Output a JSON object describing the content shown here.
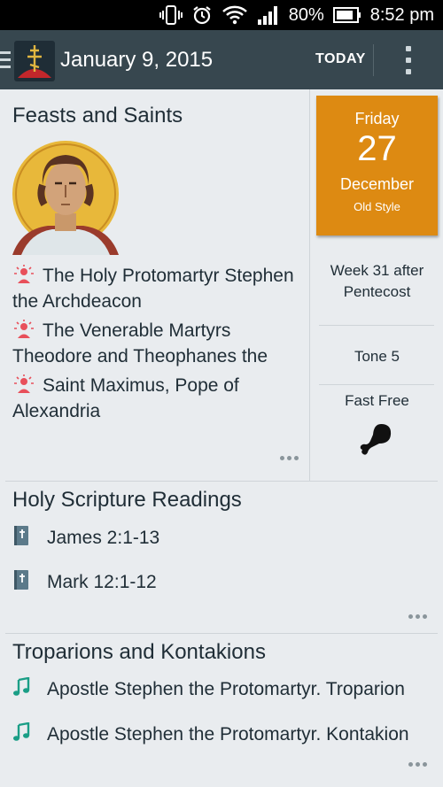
{
  "status_bar": {
    "battery": "80%",
    "time": "8:52 pm"
  },
  "action_bar": {
    "title": "January 9, 2015",
    "today_label": "TODAY"
  },
  "feasts": {
    "title": "Feasts and Saints",
    "saints": [
      "The Holy Protomartyr Stephen the Archdeacon",
      "The Venerable Martyrs Theodore and Theophanes the",
      "Saint Maximus, Pope of Alexandria"
    ]
  },
  "date_tile": {
    "weekday": "Friday",
    "day": "27",
    "month": "December",
    "style": "Old Style"
  },
  "week": "Week 31 after Pentecost",
  "tone": "Tone 5",
  "fast": "Fast Free",
  "readings": {
    "title": "Holy Scripture Readings",
    "items": [
      "James 2:1-13",
      "Mark 12:1-12"
    ]
  },
  "troparions": {
    "title": "Troparions and Kontakions",
    "items": [
      "Apostle Stephen the Protomartyr. Troparion",
      "Apostle Stephen the Protomartyr. Kontakion"
    ]
  },
  "colors": {
    "accent_tile": "#dd8a12",
    "action_bar": "#37474f",
    "saint_icon": "#e8505b",
    "music_icon": "#1a9e86",
    "book_icon": "#5c7a8a"
  },
  "icons": {
    "vibrate": "vibrate-icon",
    "alarm": "alarm-icon",
    "wifi": "wifi-icon",
    "signal": "signal-icon",
    "battery": "battery-icon",
    "app": "orthodox-cross-logo",
    "overflow": "overflow-menu-icon",
    "saint": "saint-halo-icon",
    "book": "bible-icon",
    "music": "music-note-icon",
    "fast": "meat-drumstick-icon",
    "more": "more-dots-icon"
  }
}
